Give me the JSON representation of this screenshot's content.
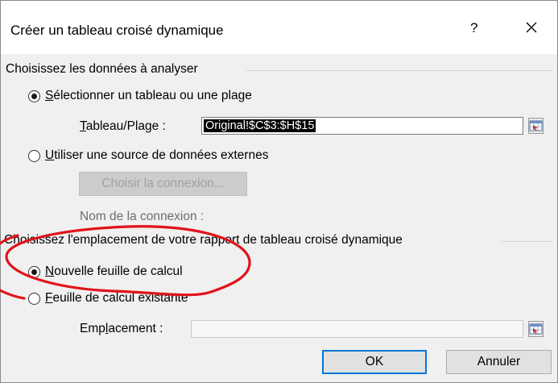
{
  "dialog": {
    "title": "Créer un tableau croisé dynamique",
    "help_label": "?",
    "close_icon": "close-icon"
  },
  "section_data": {
    "header": "Choisissez les données à analyser",
    "option_table": {
      "label_prefix": "S",
      "label_rest": "électionner un tableau ou une plage",
      "selected": true
    },
    "range_label_prefix": "T",
    "range_label_rest": "ableau/Plage :",
    "range_value": "Original!$C$3:$H$15",
    "option_external": {
      "label_prefix": "U",
      "label_rest": "tiliser une source de données externes",
      "selected": false
    },
    "choose_connection_label": "Choisir la connexion...",
    "connection_name_label": "Nom de la connexion :"
  },
  "section_location": {
    "header": "Choisissez l'emplacement de votre rapport de tableau croisé dynamique",
    "option_new": {
      "label_prefix": "N",
      "label_rest": "ouvelle feuille de calcul",
      "selected": true
    },
    "option_existing": {
      "label_prefix": "F",
      "label_rest": "euille de calcul existante",
      "selected": false
    },
    "location_label_prefix": "Emp",
    "location_label_u": "l",
    "location_label_rest": "acement :",
    "location_value": ""
  },
  "buttons": {
    "ok": "OK",
    "cancel": "Annuler"
  },
  "icons": {
    "range_picker": "range-picker-icon"
  },
  "colors": {
    "annotation_red": "#e0141b",
    "default_button_border": "#0078d7"
  }
}
